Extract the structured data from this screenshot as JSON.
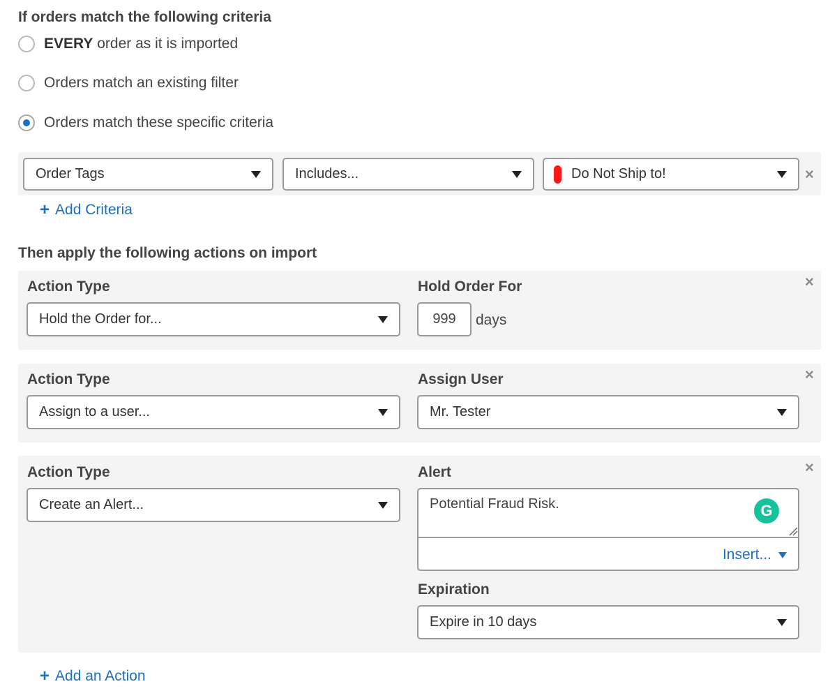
{
  "criteria_section": {
    "title": "If orders match the following criteria",
    "options": [
      {
        "bold": "EVERY",
        "text": " order as it is imported",
        "checked": false
      },
      {
        "bold": "",
        "text": "Orders match an existing filter",
        "checked": false
      },
      {
        "bold": "",
        "text": "Orders match these specific criteria",
        "checked": true
      }
    ],
    "criteria_row": {
      "field": "Order Tags",
      "operator": "Includes...",
      "tag_value": "Do Not Ship to!",
      "tag_color": "#ff1a1a",
      "remove_icon": "close-icon"
    },
    "add_criteria_label": "Add Criteria"
  },
  "actions_section": {
    "title": "Then apply the following actions on import",
    "actions": [
      {
        "type_label": "Action Type",
        "type_value": "Hold the Order for...",
        "param_label": "Hold Order For",
        "days_value": "999",
        "days_unit": "days"
      },
      {
        "type_label": "Action Type",
        "type_value": "Assign to a user...",
        "param_label": "Assign User",
        "user_value": "Mr. Tester"
      },
      {
        "type_label": "Action Type",
        "type_value": "Create an Alert...",
        "param_label": "Alert",
        "alert_text": "Potential Fraud Risk.",
        "insert_label": "Insert...",
        "expiration_label": "Expiration",
        "expiration_value": "Expire in 10 days"
      }
    ],
    "add_action_label": "Add an Action"
  },
  "colors": {
    "accent": "#1f6fc0",
    "panel_bg": "#f4f4f4",
    "grammarly": "#15c39a"
  }
}
